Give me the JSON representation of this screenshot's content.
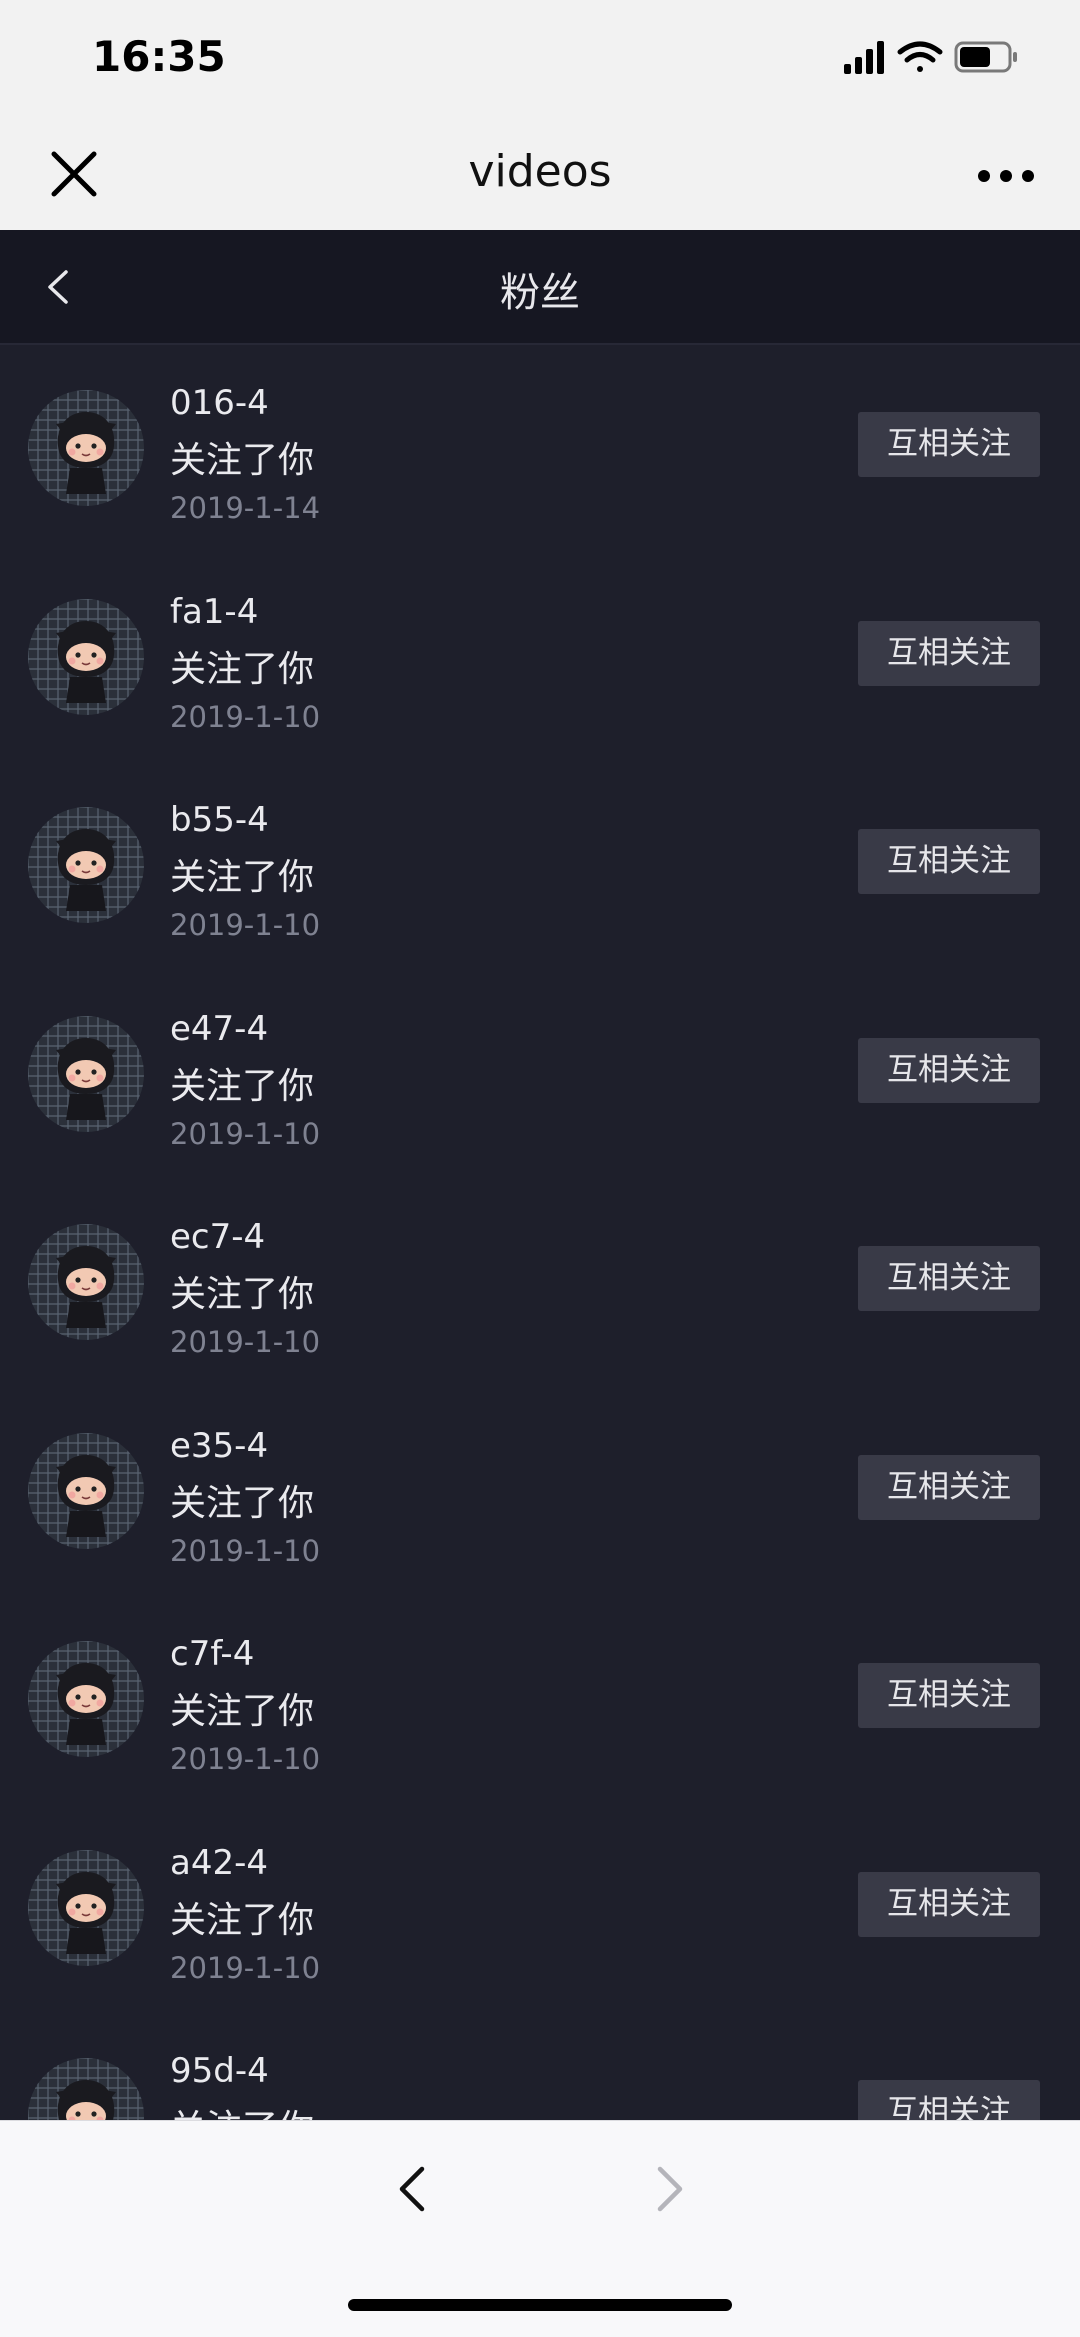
{
  "status_bar": {
    "time": "16:35"
  },
  "web_header": {
    "title": "videos"
  },
  "nav": {
    "title": "粉丝"
  },
  "followers": [
    {
      "name": "016-4",
      "action": "关注了你",
      "date": "2019-1-14",
      "button": "互相关注"
    },
    {
      "name": "fa1-4",
      "action": "关注了你",
      "date": "2019-1-10",
      "button": "互相关注"
    },
    {
      "name": "b55-4",
      "action": "关注了你",
      "date": "2019-1-10",
      "button": "互相关注"
    },
    {
      "name": "e47-4",
      "action": "关注了你",
      "date": "2019-1-10",
      "button": "互相关注"
    },
    {
      "name": "ec7-4",
      "action": "关注了你",
      "date": "2019-1-10",
      "button": "互相关注"
    },
    {
      "name": "e35-4",
      "action": "关注了你",
      "date": "2019-1-10",
      "button": "互相关注"
    },
    {
      "name": "c7f-4",
      "action": "关注了你",
      "date": "2019-1-10",
      "button": "互相关注"
    },
    {
      "name": "a42-4",
      "action": "关注了你",
      "date": "2019-1-10",
      "button": "互相关注"
    },
    {
      "name": "95d-4",
      "action": "关注了你",
      "date": "",
      "button": "互相关注"
    }
  ],
  "icons": {
    "close": "close-icon",
    "more": "more-icon",
    "back": "chevron-left-icon",
    "browser_back": "chevron-left-icon",
    "browser_forward": "chevron-right-icon",
    "avatar": "ninja-cat-avatar"
  },
  "colors": {
    "page_bg": "#1e1f2b",
    "nav_bg": "#161722",
    "button_bg": "#393a47",
    "date_text": "#7f8291"
  }
}
